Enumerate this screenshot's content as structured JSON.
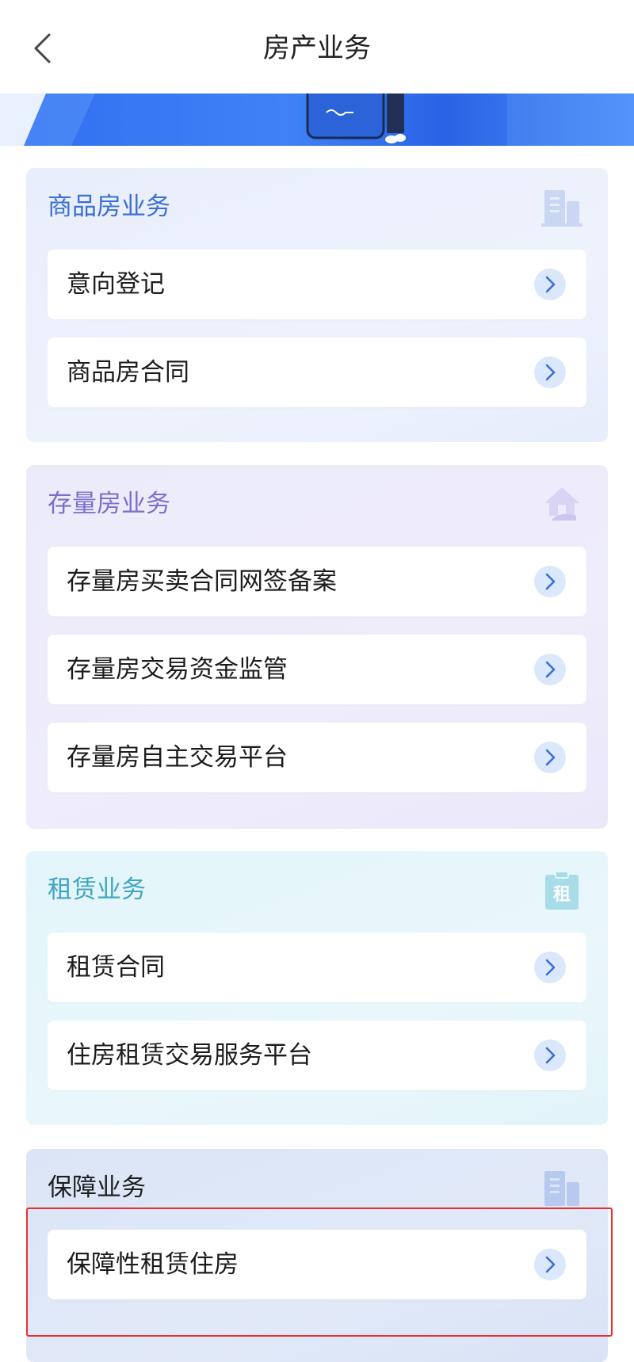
{
  "nav": {
    "title": "房产业务",
    "back_icon": "chevron-left-icon"
  },
  "sections": [
    {
      "title": "商品房业务",
      "icon": "building-icon",
      "items": [
        {
          "label": "意向登记"
        },
        {
          "label": "商品房合同"
        }
      ]
    },
    {
      "title": "存量房业务",
      "icon": "house-hand-icon",
      "items": [
        {
          "label": "存量房买卖合同网签备案"
        },
        {
          "label": "存量房交易资金监管"
        },
        {
          "label": "存量房自主交易平台"
        }
      ]
    },
    {
      "title": "租赁业务",
      "icon": "rent-clipboard-icon",
      "icon_text": "租",
      "items": [
        {
          "label": "租赁合同"
        },
        {
          "label": "住房租赁交易服务平台"
        }
      ]
    },
    {
      "title": "保障业务",
      "icon": "building-icon",
      "items": [
        {
          "label": "保障性租赁住房"
        }
      ]
    }
  ],
  "item_arrow_icon": "chevron-right-circle-icon",
  "colors": {
    "accent_blue": "#3b6fd4",
    "accent_purple": "#7b6fcc",
    "accent_teal": "#3fa5c4",
    "highlight_red": "#e8312f"
  }
}
